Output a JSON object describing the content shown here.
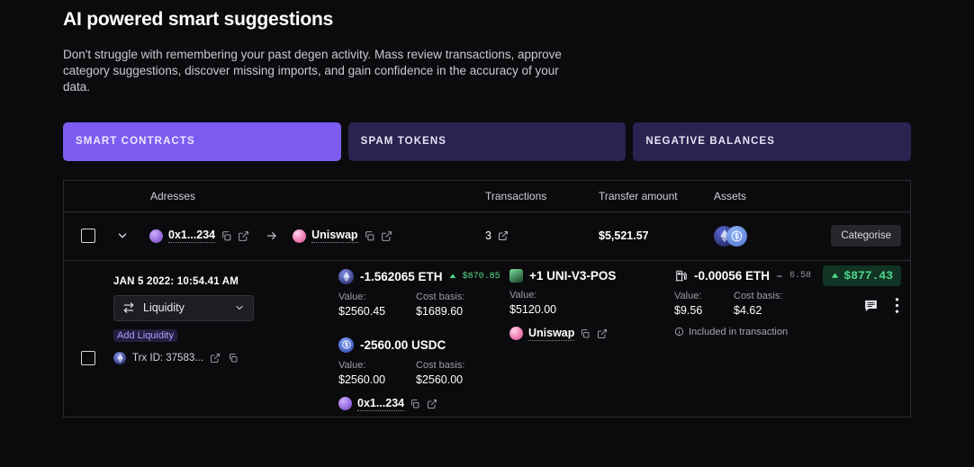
{
  "hero": {
    "title": "AI powered smart suggestions",
    "description": "Don't struggle with remembering your past degen activity. Mass review transactions, approve category suggestions, discover missing imports, and gain confidence in the accuracy of your data."
  },
  "tabs": [
    {
      "label": "SMART CONTRACTS",
      "state": "active"
    },
    {
      "label": "SPAM TOKENS",
      "state": "idle"
    },
    {
      "label": "NEGATIVE BALANCES",
      "state": "idle"
    }
  ],
  "table": {
    "headers": {
      "addresses": "Adresses",
      "transactions": "Transactions",
      "transfer_amount": "Transfer amount",
      "assets": "Assets"
    },
    "summary_row": {
      "from_address": "0x1...234",
      "to_address": "Uniswap",
      "transactions_count": "3",
      "transfer_amount": "$5,521.57",
      "categorise_label": "Categorise"
    },
    "detail_row": {
      "timestamp": "JAN 5 2022: 10:54.41 AM",
      "category_select": "Liquidity",
      "subcategory": "Add Liquidity",
      "trx_id": "Trx ID: 37583...",
      "assets": [
        {
          "amount": "-1.562065 ETH",
          "delta": "$870.85",
          "delta_direction": "up",
          "value_label": "Value:",
          "value": "$2560.45",
          "cost_basis_label": "Cost basis:",
          "cost_basis": "$1689.60"
        },
        {
          "amount": "-2560.00 USDC",
          "value_label": "Value:",
          "value": "$2560.00",
          "cost_basis_label": "Cost basis:",
          "cost_basis": "$2560.00",
          "address": "0x1...234"
        }
      ],
      "nft": {
        "amount": "+1 UNI-V3-POS",
        "value_label": "Value:",
        "value": "$5120.00",
        "protocol": "Uniswap"
      },
      "fee": {
        "amount": "-0.00056 ETH",
        "delta": "6.58",
        "value_label": "Value:",
        "value": "$9.56",
        "cost_basis_label": "Cost basis:",
        "cost_basis": "$4.62",
        "note": "Included in transaction"
      },
      "gain_badge": "$877.43"
    }
  },
  "colors": {
    "accent": "#7c5cf0",
    "tab_idle": "#2a2250",
    "positive": "#4fd98a",
    "background": "#0b0b0d"
  }
}
